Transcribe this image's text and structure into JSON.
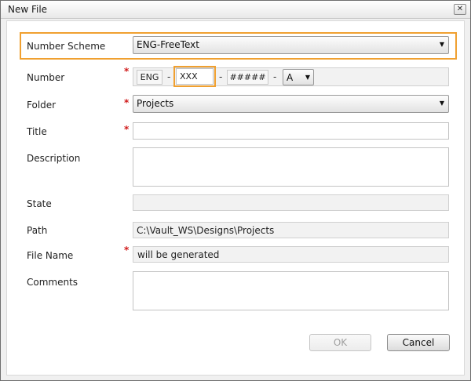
{
  "window": {
    "title": "New File",
    "close_glyph": "✕"
  },
  "form": {
    "number_scheme": {
      "label": "Number Scheme",
      "value": "ENG-FreeText",
      "arrow": "▼"
    },
    "number": {
      "label": "Number",
      "required": "*",
      "segments": [
        "ENG",
        "XXX",
        "#####"
      ],
      "separator": "-",
      "revision": "A",
      "arrow": "▼"
    },
    "folder": {
      "label": "Folder",
      "required": "*",
      "value": "Projects",
      "arrow": "▼"
    },
    "title": {
      "label": "Title",
      "required": "*",
      "value": ""
    },
    "description": {
      "label": "Description",
      "value": ""
    },
    "state": {
      "label": "State",
      "value": ""
    },
    "path": {
      "label": "Path",
      "value": "C:\\Vault_WS\\Designs\\Projects"
    },
    "file_name": {
      "label": "File Name",
      "required": "*",
      "value": "will be generated"
    },
    "comments": {
      "label": "Comments",
      "value": ""
    }
  },
  "buttons": {
    "ok": "OK",
    "cancel": "Cancel"
  }
}
